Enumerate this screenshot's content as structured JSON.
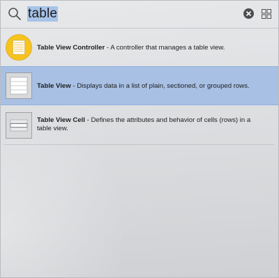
{
  "search": {
    "query": "table"
  },
  "icons": {
    "search": "magnifying-glass",
    "clear": "x-circle",
    "grid": "grid-2x2"
  },
  "results": [
    {
      "title": "Table View Controller",
      "description": " - A controller that manages a table view.",
      "icon": "yellow-circle-list-icon",
      "selected": false
    },
    {
      "title": "Table View",
      "description": " - Displays data in a list of plain, sectioned, or grouped rows.",
      "icon": "table-view-icon",
      "selected": true
    },
    {
      "title": "Table View Cell",
      "description": " - Defines the attributes and behavior of cells (rows) in a table view.",
      "icon": "table-view-cell-icon",
      "selected": false
    }
  ],
  "colors": {
    "selection": "#a8c0e4",
    "search_highlight": "#a7c3e7",
    "accent_yellow": "#f6c31f"
  }
}
